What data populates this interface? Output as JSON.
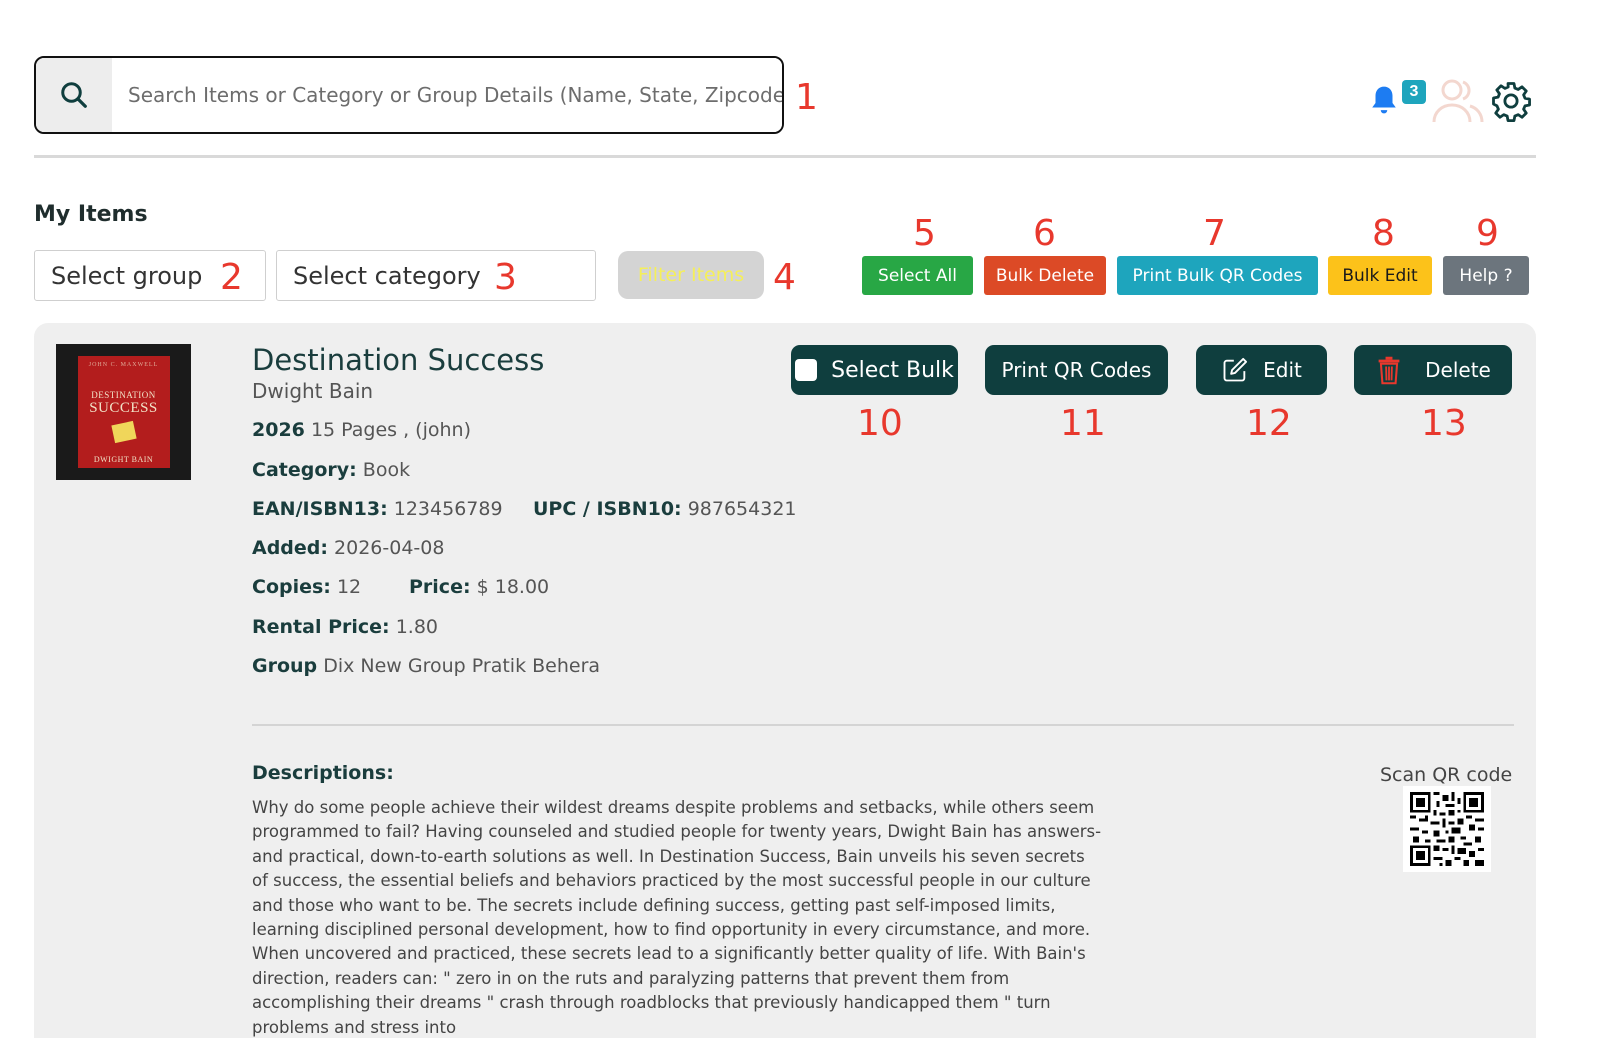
{
  "search": {
    "placeholder": "Search Items or Category or Group Details (Name, State, Zipcode)"
  },
  "notifications": {
    "count": "3"
  },
  "page": {
    "heading": "My Items"
  },
  "filters": {
    "group_placeholder": "Select group",
    "category_placeholder": "Select category",
    "filter_label": "Filter Items"
  },
  "toolbar": {
    "select_all": "Select All",
    "bulk_delete": "Bulk Delete",
    "print_bulk_qr": "Print Bulk QR Codes",
    "bulk_edit": "Bulk Edit",
    "help": "Help ?"
  },
  "annotations": [
    "1",
    "2",
    "3",
    "4",
    "5",
    "6",
    "7",
    "8",
    "9",
    "10",
    "11",
    "12",
    "13"
  ],
  "item": {
    "cover": {
      "byline": "JOHN C. MAXWELL",
      "title_top": "DESTINATION",
      "title_bottom": "SUCCESS",
      "author": "DWIGHT BAIN"
    },
    "title": "Destination Success",
    "author": "Dwight Bain",
    "year": "2026",
    "pages_info": "15 Pages , (john)",
    "category_label": "Category:",
    "category": "Book",
    "ean_label": "EAN/ISBN13:",
    "ean": "123456789",
    "upc_label": "UPC / ISBN10:",
    "upc": "987654321",
    "added_label": "Added:",
    "added": "2026-04-08",
    "copies_label": "Copies:",
    "copies": "12",
    "price_label": "Price:",
    "price": "$ 18.00",
    "rental_label": "Rental Price:",
    "rental": "1.80",
    "group_label": "Group",
    "group": "Dix New Group Pratik Behera",
    "actions": {
      "select_bulk": "Select Bulk",
      "print_qr": "Print QR Codes",
      "edit": "Edit",
      "delete": "Delete"
    },
    "descriptions_label": "Descriptions:",
    "description": "Why do some people achieve their wildest dreams despite problems and setbacks, while others seem programmed to fail? Having counseled and studied people for twenty years, Dwight Bain has answers- and practical, down-to-earth solutions as well. In Destination Success, Bain unveils his seven secrets of success, the essential beliefs and behaviors practiced by the most successful people in our culture and those who want to be. The secrets include defining success, getting past self-imposed limits, learning disciplined personal development, how to find opportunity in every circumstance, and more. When uncovered and practiced, these secrets lead to a significantly better quality of life. With Bain's direction, readers can: \" zero in on the ruts and paralyzing patterns that prevent them from accomplishing their dreams \" crash through roadblocks that previously handicapped them \" turn problems and stress into",
    "scan_label": "Scan QR code"
  },
  "colors": {
    "select_all": "#28a745",
    "bulk_delete": "#dc4a26",
    "print_bulk_qr": "#1ea5bd",
    "bulk_edit": "#fcc21a",
    "help": "#6c757d",
    "dark_teal": "#0f3e3e",
    "annotation": "#e8382d"
  }
}
